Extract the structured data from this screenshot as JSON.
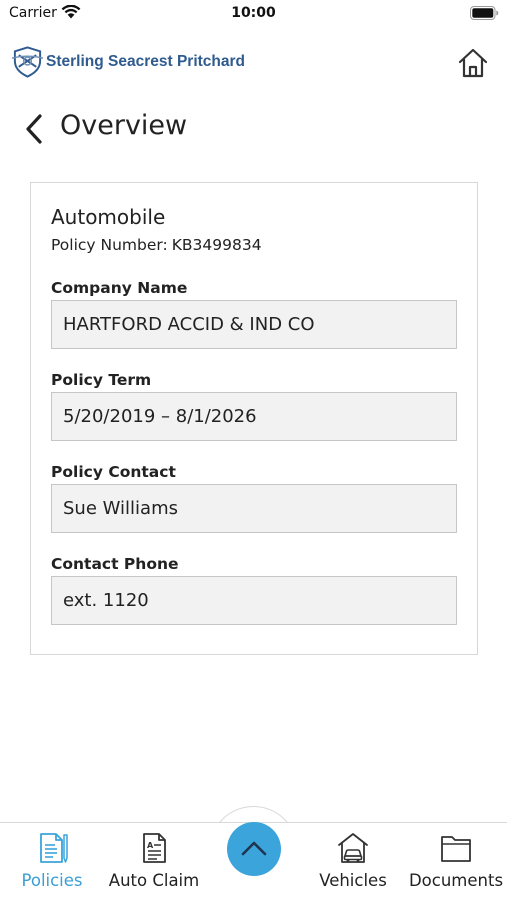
{
  "status_bar": {
    "carrier": "Carrier",
    "time": "10:00"
  },
  "header": {
    "brand_name": "Sterling Seacrest Pritchard",
    "brand_color": "#2f5b8f",
    "logo_icon": "shield-logo-icon",
    "home_icon": "home-icon"
  },
  "page": {
    "title": "Overview",
    "back_icon": "chevron-left-icon"
  },
  "policy": {
    "type": "Automobile",
    "number_label": "Policy Number:",
    "number": "KB3499834",
    "fields": [
      {
        "label": "Company Name",
        "value": "HARTFORD ACCID & IND CO"
      },
      {
        "label": "Policy Term",
        "value": "5/20/2019 – 8/1/2026"
      },
      {
        "label": "Policy Contact",
        "value": "Sue Williams"
      },
      {
        "label": "Contact Phone",
        "value": "ext. 1120"
      }
    ]
  },
  "tab_bar": {
    "accent_color": "#3aa4db",
    "tabs": [
      {
        "label": "Policies",
        "icon": "policies-document-icon",
        "active": true
      },
      {
        "label": "Auto Claim",
        "icon": "auto-claim-form-icon",
        "active": false
      },
      {
        "label": "Vehicles",
        "icon": "vehicle-garage-icon",
        "active": false
      },
      {
        "label": "Documents",
        "icon": "folder-icon",
        "active": false
      }
    ],
    "center_icon": "chevron-up-icon"
  }
}
